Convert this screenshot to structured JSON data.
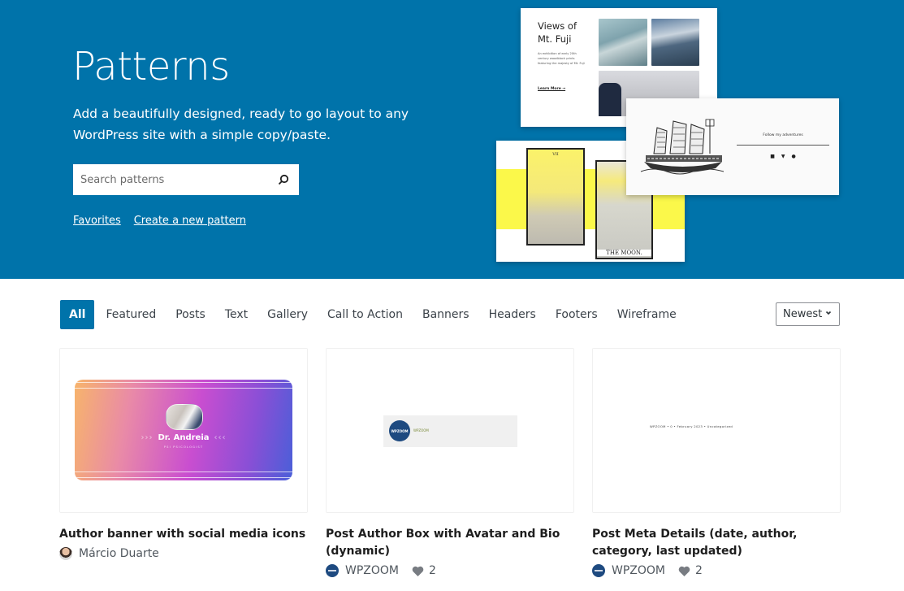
{
  "hero": {
    "title": "Patterns",
    "description": "Add a beautifully designed, ready to go layout to any WordPress site with a simple copy/paste.",
    "search_placeholder": "Search patterns",
    "search_icon": "search-icon",
    "links": [
      "Favorites",
      "Create a new pattern"
    ],
    "background_color": "#0073aa",
    "preview_collage": {
      "fuji": {
        "title": "Views of Mt. Fuji",
        "description": "An exhibition of early 20th century woodblock prints featuring the majesty of Mt. Fuji",
        "link": "Learn More →"
      },
      "tarot": {
        "card_1_number": "VII",
        "card_2_label": "THE MOON."
      },
      "ship": {
        "follow_text": "Follow my adventures",
        "social_icons": [
          "instagram-icon",
          "twitter-icon",
          "facebook-icon"
        ]
      }
    }
  },
  "filters": {
    "tabs": [
      {
        "label": "All",
        "active": true
      },
      {
        "label": "Featured",
        "active": false
      },
      {
        "label": "Posts",
        "active": false
      },
      {
        "label": "Text",
        "active": false
      },
      {
        "label": "Gallery",
        "active": false
      },
      {
        "label": "Call to Action",
        "active": false
      },
      {
        "label": "Banners",
        "active": false
      },
      {
        "label": "Headers",
        "active": false
      },
      {
        "label": "Footers",
        "active": false
      },
      {
        "label": "Wireframe",
        "active": false
      }
    ],
    "sort": {
      "selected": "Newest"
    },
    "accent_color": "#0073aa"
  },
  "patterns": [
    {
      "title": "Author banner with social media icons",
      "author": "Márcio Duarte",
      "likes": null,
      "preview": {
        "name": "Dr. Andreia",
        "subtitle": "PSI PSICOLOGIST",
        "arrows_left": "›››",
        "arrows_right": "‹‹‹"
      }
    },
    {
      "title": "Post Author Box with Avatar and Bio (dynamic)",
      "author": "WPZOOM",
      "likes": "2",
      "preview": {
        "logo_text": "WPZOOM",
        "name": "WPZOOM"
      }
    },
    {
      "title": "Post Meta Details (date, author, category, last updated)",
      "author": "WPZOOM",
      "likes": "2",
      "preview": {
        "meta_text": "WPZOOM • 0 • February 2023 • Uncategorized"
      }
    }
  ]
}
